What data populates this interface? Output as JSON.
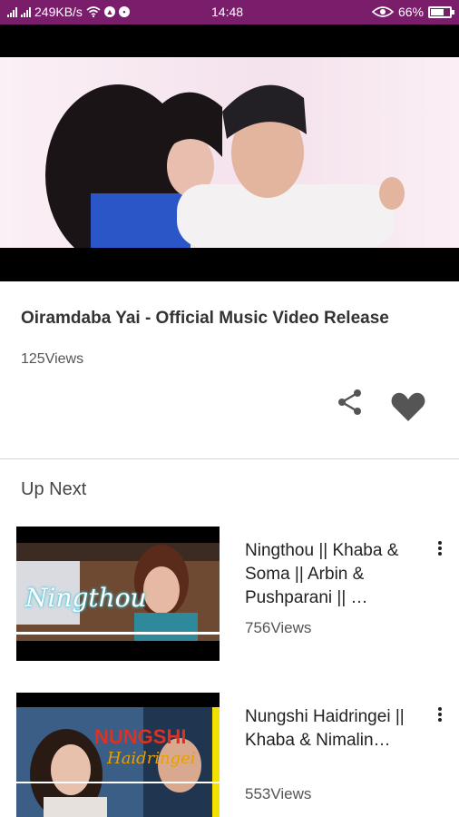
{
  "status_bar": {
    "speed": "249KB/s",
    "time": "14:48",
    "battery": "66%",
    "icons": [
      "signal-icon",
      "signal-icon",
      "wifi-icon",
      "drive-icon",
      "chat-icon",
      "eye-icon",
      "battery-icon"
    ]
  },
  "video": {
    "title": "Oiramdaba Yai - Official Music Video Release",
    "views": "125Views",
    "actions": [
      "share-icon",
      "heart-icon"
    ]
  },
  "up_next": {
    "heading": "Up Next",
    "items": [
      {
        "title": "Ningthou || Khaba & Soma || Arbin & Pushparani || …",
        "views": "756Views",
        "thumb_caption": "Ningthou"
      },
      {
        "title": "Nungshi Haidringei || Khaba & Nimalin…",
        "views": "553Views",
        "thumb_caption_1": "NUNGSHI",
        "thumb_caption_2": "Haidringei"
      }
    ]
  },
  "colors": {
    "status_bar": "#7a1e6c",
    "icon_gray": "#555555"
  }
}
